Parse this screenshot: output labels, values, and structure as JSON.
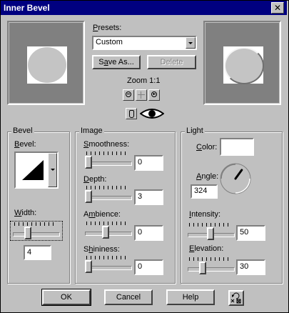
{
  "window": {
    "title": "Inner Bevel",
    "close_label": "✕"
  },
  "presets": {
    "label_pre": "",
    "label_u": "P",
    "label_post": "resets:",
    "selected": "Custom",
    "save_as_pre": "S",
    "save_as_u": "a",
    "save_as_post": "ve As...",
    "delete_label": "Delete"
  },
  "zoom": {
    "label": "Zoom 1:1"
  },
  "bevel": {
    "group_label": "Bevel",
    "bevel_label_pre": "",
    "bevel_label_u": "B",
    "bevel_label_post": "evel:",
    "width_label_pre": "",
    "width_label_u": "W",
    "width_label_post": "idth:",
    "width_value": "4",
    "width_slider_level": 0.3
  },
  "image": {
    "group_label": "Image",
    "smoothness_label_pre": "",
    "smoothness_label_u": "S",
    "smoothness_label_post": "moothness:",
    "smoothness_value": "0",
    "depth_label_pre": "",
    "depth_label_u": "D",
    "depth_label_post": "epth:",
    "depth_value": "3",
    "ambience_label_pre": "A",
    "ambience_label_u": "m",
    "ambience_label_post": "bience:",
    "ambience_value": "0",
    "shininess_label_pre": "S",
    "shininess_label_u": "h",
    "shininess_label_post": "ininess:",
    "shininess_value": "0"
  },
  "light": {
    "group_label": "Light",
    "color_label_pre": "",
    "color_label_u": "C",
    "color_label_post": "olor:",
    "color_value": "#ffffff",
    "angle_label_pre": "",
    "angle_label_u": "A",
    "angle_label_post": "ngle:",
    "angle_value": "324",
    "intensity_label_pre": "",
    "intensity_label_u": "I",
    "intensity_label_post": "ntensity:",
    "intensity_value": "50",
    "elevation_label_pre": "",
    "elevation_label_u": "E",
    "elevation_label_post": "levation:",
    "elevation_value": "30"
  },
  "footer": {
    "ok_label": "OK",
    "cancel_label": "Cancel",
    "help_label": "Help"
  },
  "colors": {
    "title_bg": "#000080",
    "face": "#c0c0c0"
  }
}
